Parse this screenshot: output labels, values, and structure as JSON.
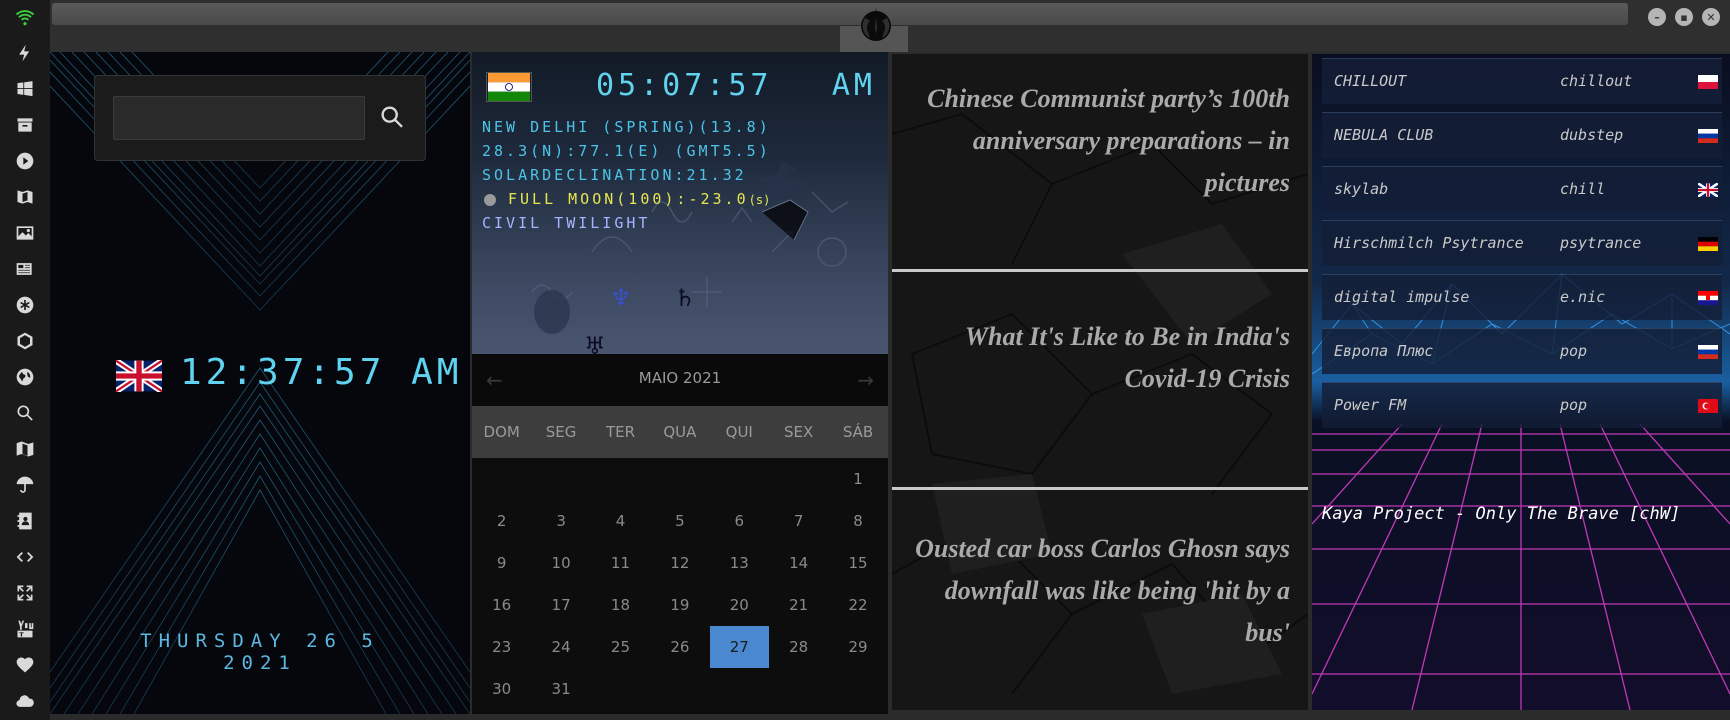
{
  "search": {
    "placeholder": "",
    "value": ""
  },
  "clock": {
    "time": "12:37:57",
    "ampm": "AM",
    "date": "THURSDAY 26 5 2021"
  },
  "world_clock": {
    "time": "05:07:57",
    "ampm": "AM",
    "city_line": "NEW DELHI (SPRING)(13.8)",
    "coords_line": "28.3(N):77.1(E) (GMT5.5)",
    "declination_line": "SOLARDECLINATION:21.32",
    "moon_line": "FULL MOON(100):-23.0",
    "moon_suffix": "(s)",
    "twilight_line": "CIVIL TWILIGHT"
  },
  "calendar": {
    "title": "MAIO 2021",
    "days_of_week": [
      "DOM",
      "SEG",
      "TER",
      "QUA",
      "QUI",
      "SEX",
      "SÁB"
    ],
    "weeks": [
      [
        "",
        "",
        "",
        "",
        "",
        "",
        "1"
      ],
      [
        "2",
        "3",
        "4",
        "5",
        "6",
        "7",
        "8"
      ],
      [
        "9",
        "10",
        "11",
        "12",
        "13",
        "14",
        "15"
      ],
      [
        "16",
        "17",
        "18",
        "19",
        "20",
        "21",
        "22"
      ],
      [
        "23",
        "24",
        "25",
        "26",
        "27",
        "28",
        "29"
      ],
      [
        "30",
        "31",
        "",
        "",
        "",
        "",
        ""
      ]
    ],
    "today": "27"
  },
  "news": {
    "items": [
      "Chinese Communist party’s 100th anniversary preparations – in pictures",
      "What It's Like to Be in India's Covid-19 Crisis",
      "Ousted car boss Carlos Ghosn says downfall was like being 'hit by a bus'"
    ]
  },
  "radio": {
    "stations": [
      {
        "name": "CHILLOUT",
        "genre": "chillout",
        "flag": "poland"
      },
      {
        "name": "NEBULA CLUB",
        "genre": "dubstep",
        "flag": "russia"
      },
      {
        "name": "skylab",
        "genre": "chill",
        "flag": "uk"
      },
      {
        "name": "Hirschmilch Psytrance",
        "genre": "psytrance",
        "flag": "germany"
      },
      {
        "name": "digital impulse",
        "genre": "e.nic",
        "flag": "croatia"
      },
      {
        "name": "Европа Плюс",
        "genre": "pop",
        "flag": "russia"
      },
      {
        "name": "Power FM",
        "genre": "pop",
        "flag": "turkey"
      }
    ],
    "now_playing": "Kaya Project - Only The Brave [chW]"
  },
  "sidebar": {
    "icons": [
      "wifi-icon",
      "bolt-icon",
      "windows-icon",
      "archive-icon",
      "play-icon",
      "map-book-icon",
      "image-icon",
      "newspaper-icon",
      "asterisk-icon",
      "hexagon-icon",
      "globe-icon",
      "search-icon",
      "map-icon",
      "umbrella-icon",
      "contacts-icon",
      "code-icon",
      "expand-icon",
      "youtube-icon",
      "heart-icon",
      "cloud-icon"
    ]
  }
}
